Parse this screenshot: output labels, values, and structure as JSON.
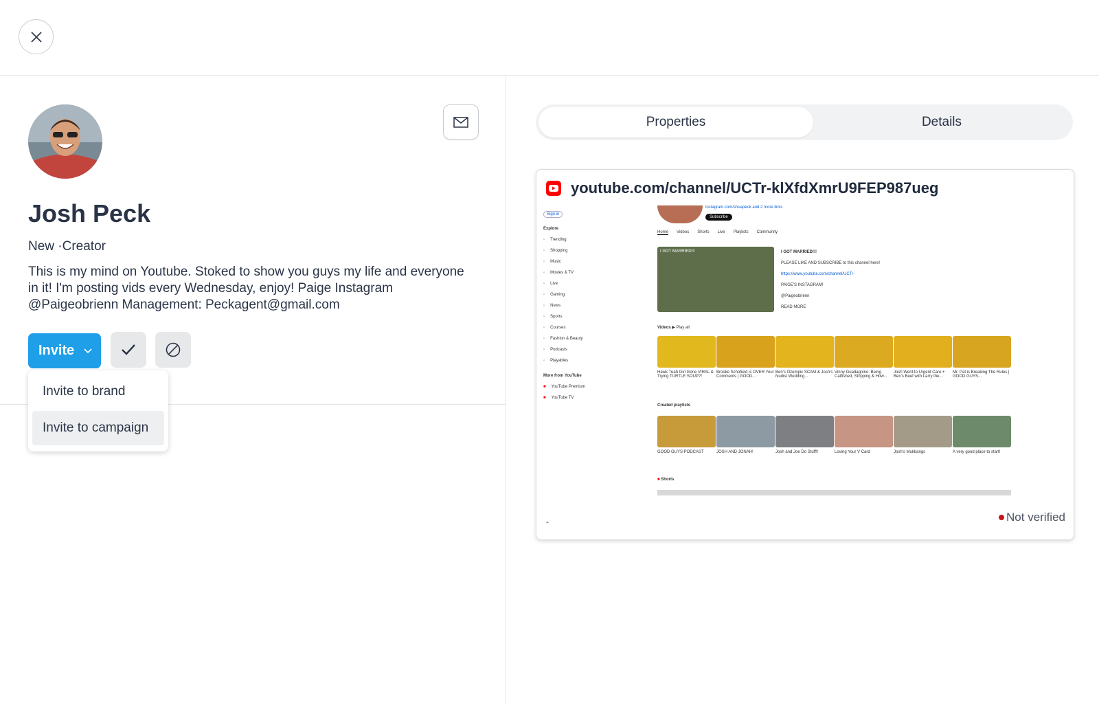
{
  "profile": {
    "name": "Josh Peck",
    "meta": "New ·Creator",
    "bio": "This is my mind on Youtube. Stoked to show you guys my life and everyone in it! I'm posting vids every Wednesday, enjoy! Paige Instagram @Paigeobrienn Management: Peckagent@gmail.com"
  },
  "actions": {
    "invite_label": "Invite",
    "menu": [
      "Invite to brand",
      "Invite to campaign"
    ]
  },
  "tabs": [
    "Properties",
    "Details"
  ],
  "property": {
    "url": "youtube.com/channel/UCTr-klXfdXmrU9FEP987ueg",
    "footer": "-",
    "status": "Not verified"
  },
  "screenshot": {
    "sidebar": [
      "Sign in",
      "Explore",
      "Trending",
      "Shopping",
      "Music",
      "Movies & TV",
      "Live",
      "Gaming",
      "News",
      "Sports",
      "Courses",
      "Fashion & Beauty",
      "Podcasts",
      "Playables",
      "More from YouTube",
      "YouTube Premium",
      "YouTube TV"
    ],
    "channel_link": "instagram.com/shuapeck and 2 more links",
    "subscribe": "Subscribe",
    "nav": [
      "Home",
      "Videos",
      "Shorts",
      "Live",
      "Playlists",
      "Community"
    ],
    "featured_title": "I GOT MARRIED!!!",
    "featured_desc": [
      "PLEASE LIKE AND SUBSCRIBE to this channel here!",
      "https://www.youtube.com/channel/UCTr-",
      "PAIGE'S INSTAGRAM!",
      "@Paigeobrienn",
      "READ MORE"
    ],
    "videos_heading": "Videos",
    "play_all": "Play all",
    "videos": [
      "Hawk Tuah Girl Gone VIRAL & Trying TURTLE SOUP?!",
      "Brooke Schofield is OVER Your Comments | GOOD...",
      "Ben's Ozempic SCAM & Josh's Nudist Wedding...",
      "Vinny Guadagnino: Being Catfished, Stripping & How...",
      "Josh Went to Urgent Care + Ben's Beef with Larry the...",
      "Mr. Pat is Breaking The Rules | GOOD GUYS..."
    ],
    "playlists_heading": "Created playlists",
    "playlists": [
      "GOOD GUYS PODCAST",
      "JOSH AND JONAH!",
      "Josh and Joe Do Stuff!!",
      "Loving Your V Card",
      "Josh's Mukbangs",
      "A very good place to start!"
    ],
    "shorts_heading": "Shorts"
  },
  "colors": {
    "accent": "#1e9fe8",
    "youtube_red": "#ff0000",
    "status_dot": "#c4161c"
  }
}
